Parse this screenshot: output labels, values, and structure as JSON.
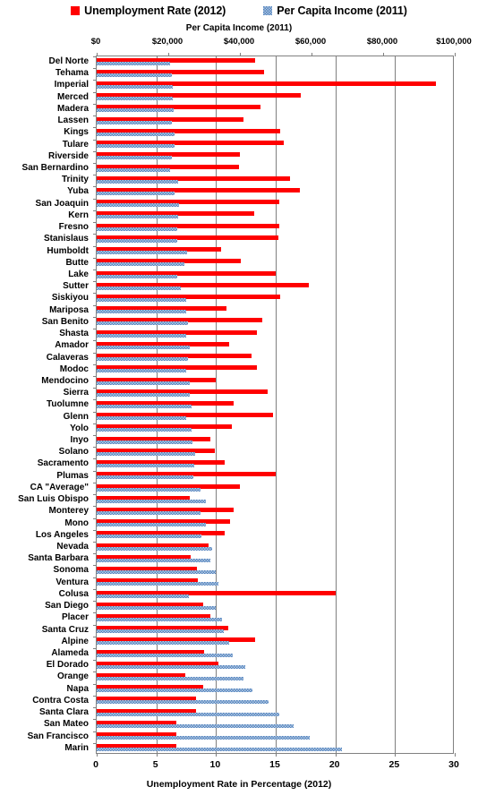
{
  "legend": {
    "entries": [
      {
        "label": "Unemployment Rate (2012)",
        "color": "#FF0000",
        "swatch": "red"
      },
      {
        "label": "Per Capita Income (2011)",
        "color": "#4F81BD",
        "swatch": "blue"
      }
    ]
  },
  "axes": {
    "top_title": "Per Capita Income (2011)",
    "bottom_title": "Unemployment Rate in Percentage  (2012)",
    "top_ticks": [
      "$0",
      "$20,000",
      "$40,000",
      "$60,000",
      "$80,000",
      "$100,000"
    ],
    "bottom_ticks": [
      "0",
      "5",
      "10",
      "15",
      "20",
      "25",
      "30"
    ]
  },
  "chart_data": {
    "type": "bar",
    "orientation": "horizontal",
    "title": "",
    "subtitle": "",
    "xlabel": "Unemployment Rate in Percentage  (2012)",
    "xlabel_secondary": "Per Capita Income (2011)",
    "ylabel": "",
    "grid": true,
    "legend_position": "top",
    "xlim": [
      0,
      30
    ],
    "xlim_secondary": [
      0,
      100000
    ],
    "xticks": [
      0,
      5,
      10,
      15,
      20,
      25,
      30
    ],
    "xticks_secondary": [
      0,
      20000,
      40000,
      60000,
      80000,
      100000
    ],
    "categories": [
      "Del Norte",
      "Tehama",
      "Imperial",
      "Merced",
      "Madera",
      "Lassen",
      "Kings",
      "Tulare",
      "Riverside",
      "San Bernardino",
      "Trinity",
      "Yuba",
      "San Joaquin",
      "Kern",
      "Fresno",
      "Stanislaus",
      "Humboldt",
      "Butte",
      "Lake",
      "Sutter",
      "Siskiyou",
      "Mariposa",
      "San Benito",
      "Shasta",
      "Amador",
      "Calaveras",
      "Modoc",
      "Mendocino",
      "Sierra",
      "Tuolumne",
      "Glenn",
      "Yolo",
      "Inyo",
      "Solano",
      "Sacramento",
      "Plumas",
      "CA \"Average\"",
      "San Luis Obispo",
      "Monterey",
      "Mono",
      "Los Angeles",
      "Nevada",
      "Santa Barbara",
      "Sonoma",
      "Ventura",
      "Colusa",
      "San Diego",
      "Placer",
      "Santa Cruz",
      "Alpine",
      "Alameda",
      "El Dorado",
      "Orange",
      "Napa",
      "Contra Costa",
      "Santa Clara",
      "San Mateo",
      "San Francisco",
      "Marin"
    ],
    "series": [
      {
        "name": "Unemployment Rate (2012)",
        "color": "#FF0000",
        "unit": "percent",
        "axis": "bottom",
        "values": [
          13.3,
          14.0,
          28.4,
          17.1,
          13.7,
          12.3,
          15.4,
          15.7,
          12.0,
          11.9,
          16.2,
          17.0,
          15.3,
          13.2,
          15.3,
          15.2,
          10.4,
          12.1,
          15.0,
          17.8,
          15.4,
          10.9,
          13.9,
          13.4,
          11.1,
          13.0,
          13.4,
          10.0,
          14.3,
          11.5,
          14.8,
          11.3,
          9.5,
          9.9,
          10.7,
          15.0,
          12.0,
          7.8,
          11.5,
          11.2,
          10.7,
          9.4,
          7.9,
          8.4,
          8.5,
          20.0,
          8.9,
          9.5,
          11.0,
          13.3,
          9.0,
          10.2,
          7.4,
          8.9,
          8.3,
          8.3,
          6.7,
          6.7,
          6.7
        ]
      },
      {
        "name": "Per Capita Income (2011)",
        "color": "#4F81BD",
        "unit": "dollars",
        "axis": "top",
        "values": [
          20400,
          20900,
          21200,
          21300,
          21400,
          21000,
          21800,
          21800,
          21000,
          20400,
          22800,
          21800,
          23000,
          22800,
          22400,
          22400,
          25200,
          24400,
          22500,
          23400,
          25000,
          25100,
          25500,
          25100,
          26000,
          25500,
          24900,
          26100,
          26100,
          26600,
          25000,
          26500,
          26800,
          27600,
          27200,
          27000,
          29100,
          30500,
          29100,
          30600,
          29200,
          32200,
          31800,
          33300,
          33900,
          25700,
          33300,
          35100,
          35500,
          36900,
          38000,
          41600,
          41100,
          43400,
          47900,
          50900,
          55100,
          59500,
          68500
        ]
      }
    ]
  }
}
